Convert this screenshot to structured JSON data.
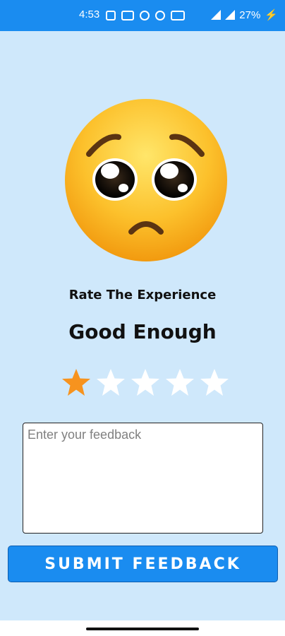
{
  "status_bar": {
    "time": "4:53",
    "battery": "27%"
  },
  "emoji": {
    "icon": "pleading-face-icon"
  },
  "rating": {
    "prompt": "Rate The Experience",
    "value_label": "Good Enough",
    "stars_total": 5,
    "stars_selected": 1,
    "selected_color": "#f7931e",
    "unselected_color": "#ffffff"
  },
  "feedback": {
    "placeholder": "Enter your feedback",
    "value": ""
  },
  "submit": {
    "label": "SUBMIT FEEDBACK",
    "color": "#1a8cf0"
  }
}
